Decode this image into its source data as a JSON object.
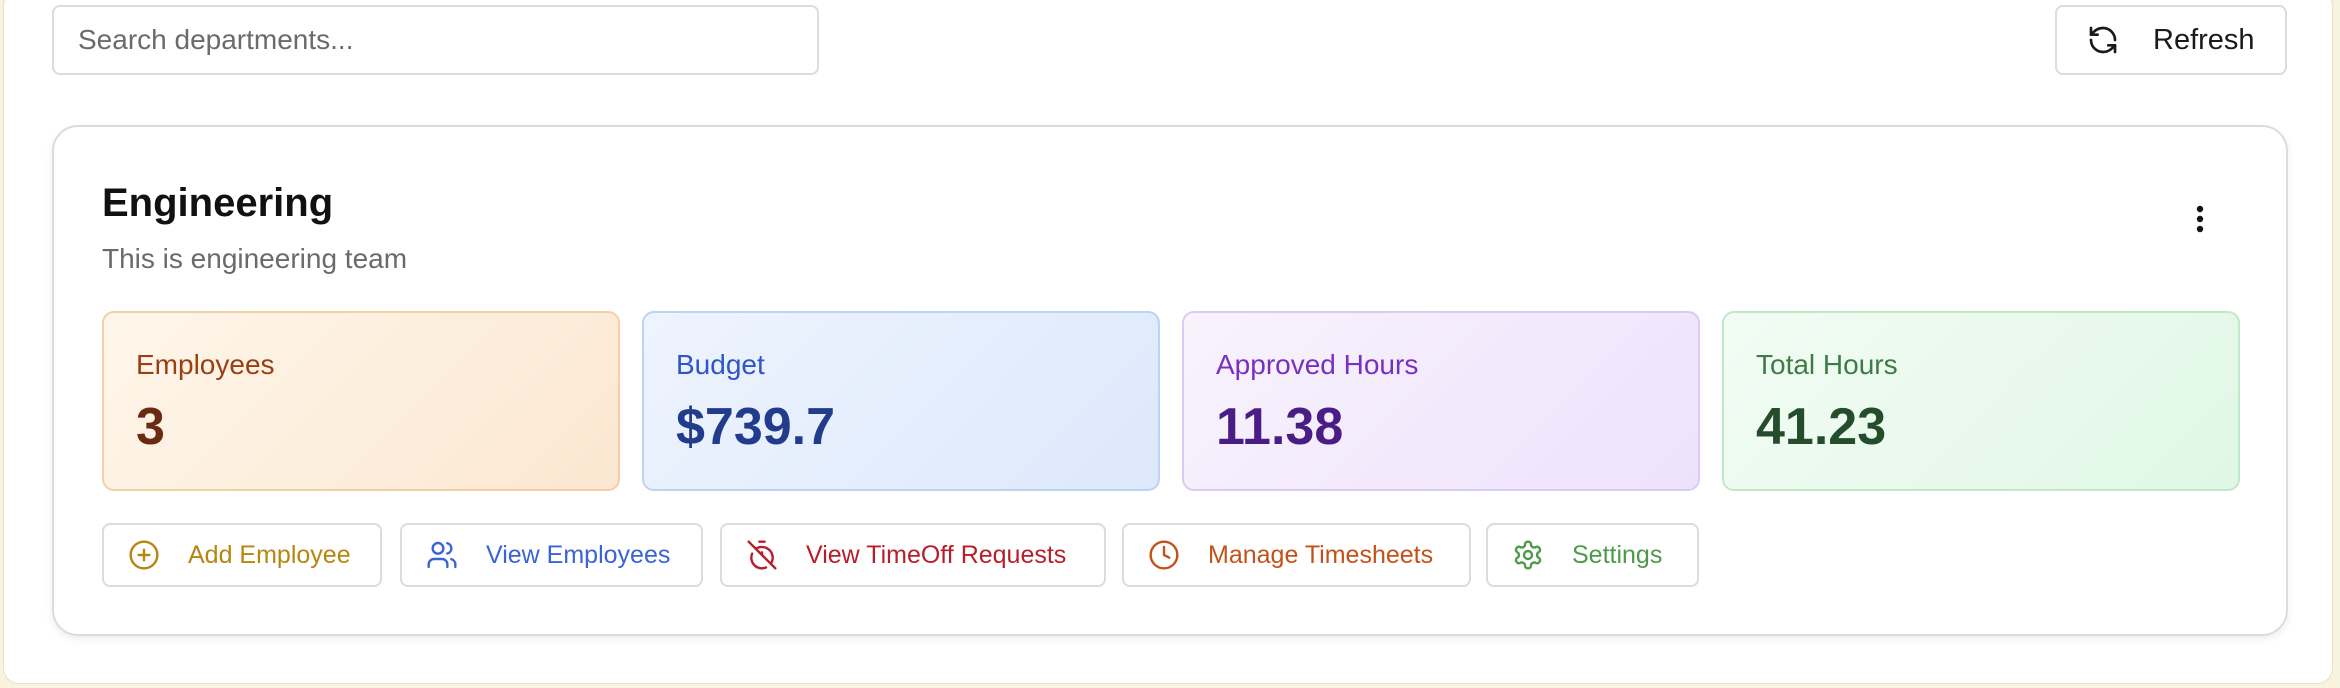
{
  "toolbar": {
    "search_placeholder": "Search departments...",
    "refresh_label": "Refresh"
  },
  "department": {
    "name": "Engineering",
    "description": "This is engineering team"
  },
  "stats": {
    "employees": {
      "label": "Employees",
      "value": "3"
    },
    "budget": {
      "label": "Budget",
      "value": "$739.7"
    },
    "approved_hours": {
      "label": "Approved Hours",
      "value": "11.38"
    },
    "total_hours": {
      "label": "Total Hours",
      "value": "41.23"
    }
  },
  "actions": {
    "add_employee": {
      "label": "Add Employee",
      "icon": "plus-circle-icon",
      "color": "#b7860e"
    },
    "view_employees": {
      "label": "View Employees",
      "icon": "users-icon",
      "color": "#3a63d8"
    },
    "view_timeoff": {
      "label": "View TimeOff Requests",
      "icon": "timer-off-icon",
      "color": "#b81e2a"
    },
    "manage_timesheets": {
      "label": "Manage Timesheets",
      "icon": "clock-icon",
      "color": "#c4511a"
    },
    "settings": {
      "label": "Settings",
      "icon": "gear-icon",
      "color": "#4f9a48"
    }
  }
}
